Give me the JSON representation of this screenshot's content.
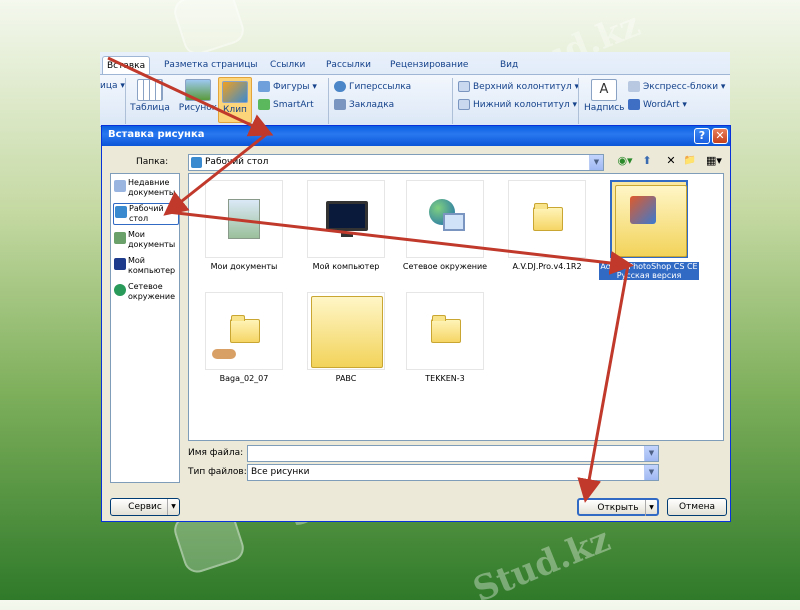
{
  "watermark": "Stud.kz",
  "ribbon": {
    "tabs": [
      "Вставка",
      "Разметка страницы",
      "Ссылки",
      "Рассылки",
      "Рецензирование",
      "Вид"
    ],
    "left_fragment": "ица ▾",
    "big_buttons": [
      "Таблица",
      "Рисунок",
      "Клип",
      "Надпись"
    ],
    "items": [
      "Фигуры ▾",
      "SmartArt",
      "Гиперссылка",
      "Закладка",
      "Верхний колонтитул ▾",
      "Нижний колонтитул ▾",
      "Экспресс-блоки ▾",
      "WordArt ▾"
    ]
  },
  "dialog": {
    "title": "Вставка рисунка",
    "help_label": "?",
    "close_label": "✕",
    "folder_label": "Папка:",
    "folder_value": "Рабочий стол",
    "toolbar_icons": [
      "◉▾",
      "⬆",
      "✕",
      "📁",
      "▦▾"
    ],
    "places": [
      {
        "label": "Недавние документы"
      },
      {
        "label": "Рабочий стол"
      },
      {
        "label": "Мои документы"
      },
      {
        "label": "Мой компьютер"
      },
      {
        "label": "Сетевое окружение"
      }
    ],
    "files": [
      {
        "name": "Мои документы"
      },
      {
        "name": "Мой компьютер"
      },
      {
        "name": "Сетевое окружение"
      },
      {
        "name": "A.V.DJ.Pro.v4.1R2"
      },
      {
        "name": "Adobe PhotoShop CS CE Русская версия"
      },
      {
        "name": "Baga_02_07"
      },
      {
        "name": "PABC"
      },
      {
        "name": "TEKKEN-3"
      }
    ],
    "filename_label": "Имя файла:",
    "filename_value": "",
    "filetype_label": "Тип файлов:",
    "filetype_value": "Все рисунки",
    "service_button": "Сервис",
    "open_button": "Открыть",
    "cancel_button": "Отмена"
  },
  "colors": {
    "title_bar": "#0a5fe0",
    "selection": "#316ac5",
    "annotation_arrow": "#c0392b"
  }
}
